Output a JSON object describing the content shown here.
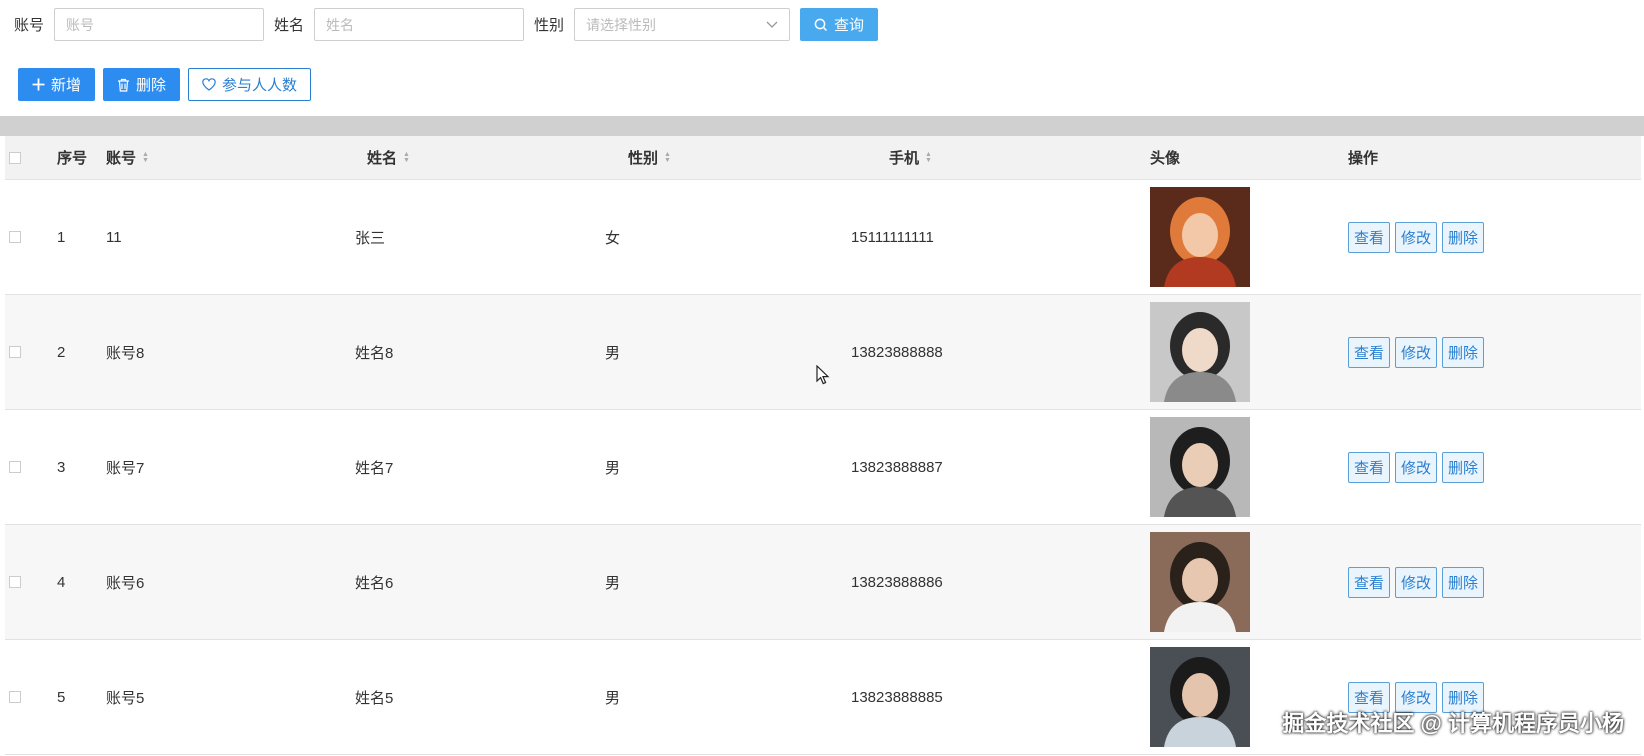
{
  "search": {
    "account_label": "账号",
    "account_placeholder": "账号",
    "name_label": "姓名",
    "name_placeholder": "姓名",
    "gender_label": "性别",
    "gender_placeholder": "请选择性别",
    "query_label": "查询"
  },
  "actions": {
    "add_label": "新增",
    "delete_label": "删除",
    "participants_label": "参与人人数"
  },
  "table": {
    "headers": {
      "index": "序号",
      "account": "账号",
      "name": "姓名",
      "gender": "性别",
      "phone": "手机",
      "avatar": "头像",
      "operations": "操作"
    },
    "row_actions": {
      "view": "查看",
      "edit": "修改",
      "delete": "删除"
    },
    "rows": [
      {
        "index": "1",
        "account": "11",
        "name": "张三",
        "gender": "女",
        "phone": "15111111111",
        "avatar_colors": [
          "#5a2a1a",
          "#e07a3a",
          "#f2c8a8",
          "#b23a20"
        ]
      },
      {
        "index": "2",
        "account": "账号8",
        "name": "姓名8",
        "gender": "男",
        "phone": "13823888888",
        "avatar_colors": [
          "#c8c8c8",
          "#2a2a2a",
          "#efd9c8",
          "#8a8a8a"
        ]
      },
      {
        "index": "3",
        "account": "账号7",
        "name": "姓名7",
        "gender": "男",
        "phone": "13823888887",
        "avatar_colors": [
          "#b8b8b8",
          "#1e1e1e",
          "#e9cdb6",
          "#545454"
        ]
      },
      {
        "index": "4",
        "account": "账号6",
        "name": "姓名6",
        "gender": "男",
        "phone": "13823888886",
        "avatar_colors": [
          "#8a6a58",
          "#2b211b",
          "#e8c7b0",
          "#f2f2f2"
        ]
      },
      {
        "index": "5",
        "account": "账号5",
        "name": "姓名5",
        "gender": "男",
        "phone": "13823888885",
        "avatar_colors": [
          "#4a4f56",
          "#1b1b1b",
          "#e4c4ac",
          "#c9d3dc"
        ]
      }
    ]
  },
  "watermark": "掘金技术社区 @ 计算机程序员小杨",
  "colors": {
    "primary": "#2d8cf0",
    "query": "#49a9ee",
    "outline": "#2a7fd0"
  }
}
